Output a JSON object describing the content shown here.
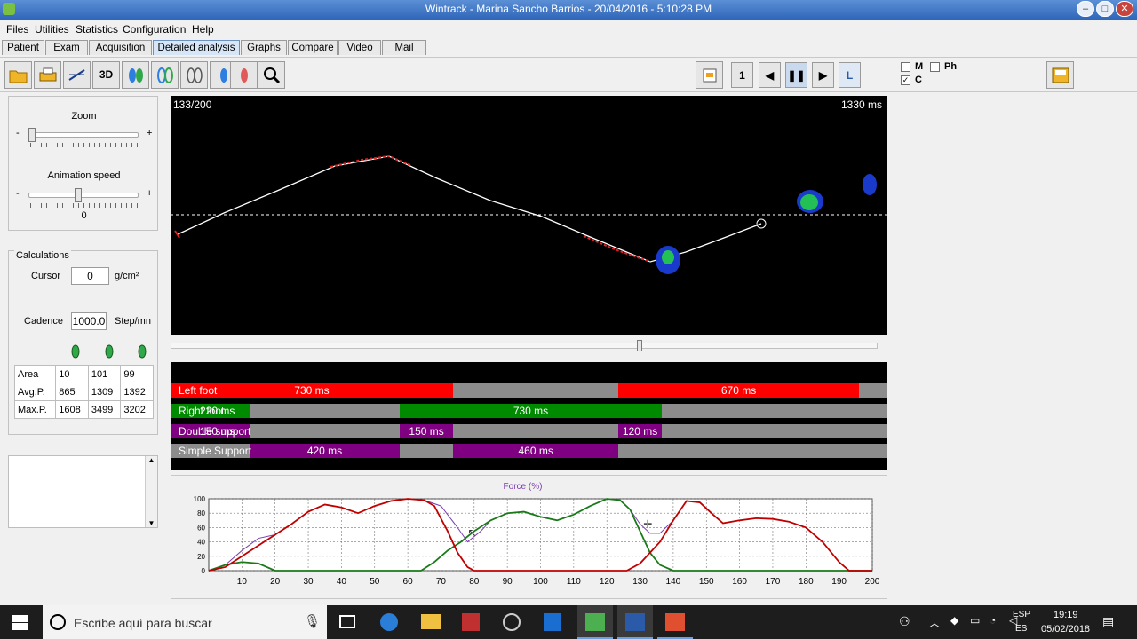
{
  "window": {
    "title": "Wintrack - Marina Sancho Barrios - 20/04/2016 - 5:10:28 PM"
  },
  "menu": [
    "Files",
    "Utilities",
    "Statistics",
    "Configuration",
    "Help"
  ],
  "tabs": [
    "Patient",
    "Exam",
    "Acquisition",
    "Detailed analysis",
    "Graphs",
    "Compare",
    "Video",
    "Mail"
  ],
  "active_tab": "Detailed analysis",
  "toolbar": {
    "btn_3d": "3D",
    "frame_step": "1",
    "side": "L",
    "checks": {
      "m": "M",
      "ph": "Ph",
      "c": "C"
    },
    "check_states": {
      "m": false,
      "ph": false,
      "c": true
    }
  },
  "zoom_panel": {
    "zoom_label": "Zoom",
    "minus": "-",
    "plus": "+",
    "zoom_level": 0.0,
    "speed_label": "Animation speed",
    "speed_level": 0.45,
    "speed_value": "0"
  },
  "calculations": {
    "title": "Calculations",
    "cursor_label": "Cursor",
    "cursor_value": "0",
    "cursor_unit": "g/cm²",
    "cadence_label": "Cadence",
    "cadence_value": "1000.0",
    "cadence_unit": "Step/mn",
    "rows": [
      {
        "label": "Area",
        "v1": "10",
        "v2": "101",
        "v3": "99"
      },
      {
        "label": "Avg.P.",
        "v1": "865",
        "v2": "1309",
        "v3": "1392"
      },
      {
        "label": "Max.P.",
        "v1": "1608",
        "v2": "3499",
        "v3": "3202"
      }
    ]
  },
  "viewer": {
    "frame": "133/200",
    "time": "1330 ms",
    "scrub_position": 0.665
  },
  "timeline": {
    "rows": [
      {
        "label": "Left foot",
        "segments": [
          {
            "from": 0.0,
            "to": 0.394,
            "color": "#ff0000",
            "text": "730 ms"
          },
          {
            "from": 0.394,
            "to": 0.625,
            "color": "#8c8c8c",
            "text": ""
          },
          {
            "from": 0.625,
            "to": 0.96,
            "color": "#ff0000",
            "text": "670 ms"
          },
          {
            "from": 0.96,
            "to": 1.0,
            "color": "#8c8c8c",
            "text": ""
          }
        ]
      },
      {
        "label": "Right foot",
        "overlay": "220 ms",
        "segments": [
          {
            "from": 0.0,
            "to": 0.11,
            "color": "#008a00",
            "text": ""
          },
          {
            "from": 0.11,
            "to": 0.32,
            "color": "#8c8c8c",
            "text": ""
          },
          {
            "from": 0.32,
            "to": 0.685,
            "color": "#008a00",
            "text": "730 ms"
          },
          {
            "from": 0.685,
            "to": 1.0,
            "color": "#8c8c8c",
            "text": ""
          }
        ]
      },
      {
        "label": "Double support",
        "overlay": "150 ms",
        "segments": [
          {
            "from": 0.0,
            "to": 0.11,
            "color": "#7f0080",
            "text": ""
          },
          {
            "from": 0.11,
            "to": 0.32,
            "color": "#8c8c8c",
            "text": ""
          },
          {
            "from": 0.32,
            "to": 0.394,
            "color": "#7f0080",
            "text": "150 ms"
          },
          {
            "from": 0.394,
            "to": 0.625,
            "color": "#8c8c8c",
            "text": ""
          },
          {
            "from": 0.625,
            "to": 0.685,
            "color": "#7f0080",
            "text": "120 ms"
          },
          {
            "from": 0.685,
            "to": 1.0,
            "color": "#8c8c8c",
            "text": ""
          }
        ]
      },
      {
        "label": "Simple Support",
        "segments": [
          {
            "from": 0.0,
            "to": 0.11,
            "color": "#8c8c8c",
            "text": ""
          },
          {
            "from": 0.11,
            "to": 0.32,
            "color": "#7f0080",
            "text": "420 ms"
          },
          {
            "from": 0.32,
            "to": 0.394,
            "color": "#8c8c8c",
            "text": ""
          },
          {
            "from": 0.394,
            "to": 0.625,
            "color": "#7f0080",
            "text": "460 ms"
          },
          {
            "from": 0.625,
            "to": 1.0,
            "color": "#8c8c8c",
            "text": ""
          }
        ]
      }
    ]
  },
  "chart_data": {
    "type": "line",
    "title": "Force (%)",
    "xlim": [
      0,
      200
    ],
    "ylim": [
      0,
      100
    ],
    "xticks": [
      10,
      20,
      30,
      40,
      50,
      60,
      70,
      80,
      90,
      100,
      110,
      120,
      130,
      140,
      150,
      160,
      170,
      180,
      190,
      200
    ],
    "yticks": [
      0,
      20,
      40,
      60,
      80,
      100
    ],
    "grid": true,
    "series": [
      {
        "color": "#c00000",
        "x": [
          0,
          5,
          10,
          15,
          20,
          25,
          30,
          35,
          40,
          45,
          50,
          55,
          60,
          65,
          68,
          72,
          75,
          78,
          80,
          85,
          90,
          100,
          110,
          120,
          126,
          130,
          133,
          136,
          140,
          144,
          148,
          152,
          155,
          160,
          165,
          170,
          175,
          180,
          185,
          190,
          193,
          200
        ],
        "y": [
          0,
          5,
          20,
          35,
          50,
          65,
          82,
          92,
          88,
          80,
          90,
          97,
          100,
          98,
          90,
          55,
          25,
          5,
          0,
          0,
          0,
          0,
          0,
          0,
          0,
          10,
          25,
          40,
          70,
          97,
          95,
          78,
          66,
          70,
          73,
          72,
          68,
          60,
          40,
          12,
          0,
          0
        ]
      },
      {
        "color": "#1a7a1a",
        "x": [
          0,
          5,
          10,
          15,
          20,
          30,
          40,
          50,
          60,
          64,
          68,
          72,
          76,
          80,
          85,
          90,
          95,
          100,
          105,
          110,
          115,
          120,
          124,
          127,
          130,
          133,
          136,
          140,
          145,
          150,
          200
        ],
        "y": [
          0,
          8,
          12,
          10,
          0,
          0,
          0,
          0,
          0,
          0,
          12,
          28,
          40,
          55,
          70,
          80,
          82,
          75,
          70,
          78,
          90,
          100,
          98,
          85,
          55,
          25,
          8,
          0,
          0,
          0,
          0
        ]
      },
      {
        "color": "#7a3fb0",
        "x": [
          0,
          5,
          10,
          15,
          20,
          25,
          30,
          35,
          40,
          45,
          50,
          55,
          60,
          65,
          70,
          75,
          78,
          82,
          85,
          90,
          95,
          100,
          105,
          110,
          115,
          120,
          124,
          127,
          130,
          133,
          136,
          140,
          144,
          148,
          152,
          155,
          160,
          165,
          170,
          175,
          180,
          185,
          190,
          193,
          200
        ],
        "y": [
          0,
          8,
          28,
          45,
          50,
          65,
          82,
          92,
          88,
          80,
          90,
          97,
          100,
          98,
          90,
          60,
          40,
          55,
          70,
          80,
          82,
          75,
          70,
          78,
          90,
          100,
          98,
          85,
          65,
          52,
          52,
          70,
          97,
          95,
          78,
          66,
          70,
          73,
          72,
          68,
          60,
          40,
          12,
          0,
          0
        ]
      }
    ]
  },
  "side_panel_notes": "",
  "taskbar": {
    "search_placeholder": "Escribe aquí para buscar",
    "lang_top": "ESP",
    "lang_bottom": "ES",
    "time": "19:19",
    "date": "05/02/2018"
  }
}
